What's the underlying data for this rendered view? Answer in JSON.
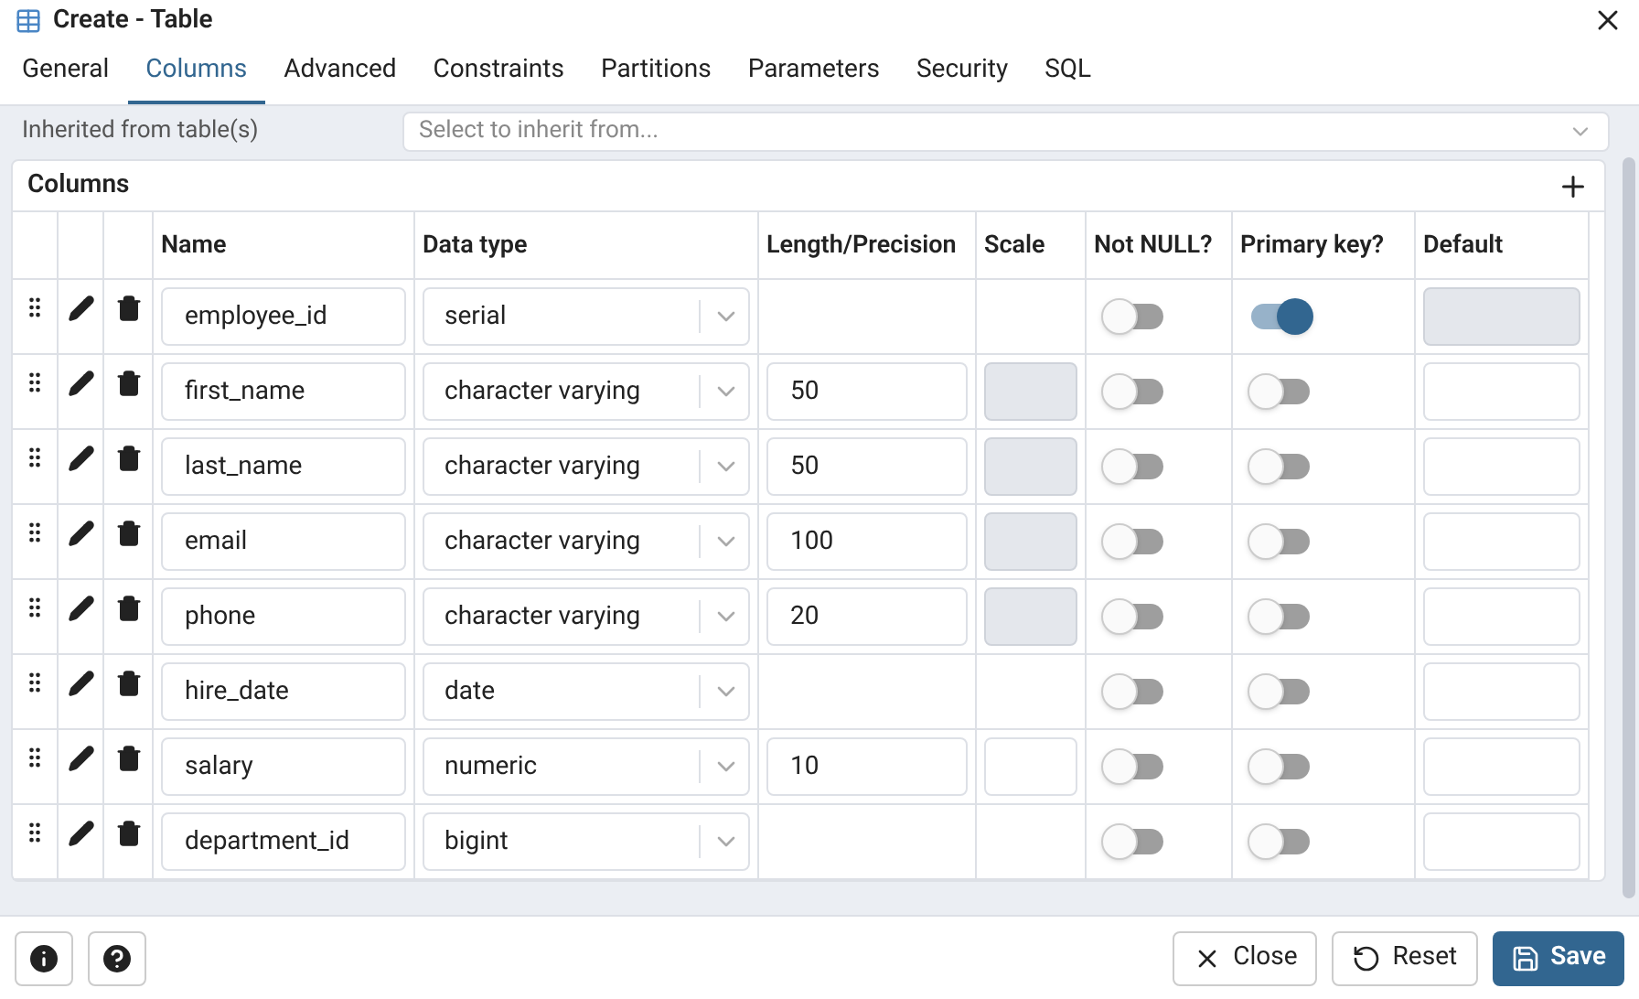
{
  "window": {
    "title": "Create - Table"
  },
  "tabs": [
    {
      "label": "General",
      "selected": false
    },
    {
      "label": "Columns",
      "selected": true
    },
    {
      "label": "Advanced",
      "selected": false
    },
    {
      "label": "Constraints",
      "selected": false
    },
    {
      "label": "Partitions",
      "selected": false
    },
    {
      "label": "Parameters",
      "selected": false
    },
    {
      "label": "Security",
      "selected": false
    },
    {
      "label": "SQL",
      "selected": false
    }
  ],
  "inherit": {
    "label": "Inherited from table(s)",
    "placeholder": "Select to inherit from..."
  },
  "columns_panel": {
    "title": "Columns",
    "headers": [
      "Name",
      "Data type",
      "Length/Precision",
      "Scale",
      "Not NULL?",
      "Primary key?",
      "Default"
    ],
    "rows": [
      {
        "name": "employee_id",
        "data_type": "serial",
        "not_null": false,
        "primary_key": true,
        "default_disabled": true
      },
      {
        "name": "first_name",
        "data_type": "character varying",
        "length": "50",
        "scale_disabled": true,
        "not_null": false,
        "primary_key": false,
        "default_disabled": false
      },
      {
        "name": "last_name",
        "data_type": "character varying",
        "length": "50",
        "scale_disabled": true,
        "not_null": false,
        "primary_key": false,
        "default_disabled": false
      },
      {
        "name": "email",
        "data_type": "character varying",
        "length": "100",
        "scale_disabled": true,
        "not_null": false,
        "primary_key": false,
        "default_disabled": false
      },
      {
        "name": "phone",
        "data_type": "character varying",
        "length": "20",
        "scale_disabled": true,
        "not_null": false,
        "primary_key": false,
        "default_disabled": false
      },
      {
        "name": "hire_date",
        "data_type": "date",
        "not_null": false,
        "primary_key": false,
        "default_disabled": false
      },
      {
        "name": "salary",
        "data_type": "numeric",
        "length": "10",
        "scale_disabled": false,
        "not_null": false,
        "primary_key": false,
        "default_disabled": false
      },
      {
        "name": "department_id",
        "data_type": "bigint",
        "not_null": false,
        "primary_key": false,
        "default_disabled": false
      }
    ]
  },
  "footer": {
    "buttons": [
      {
        "label": "Close",
        "kind": "close"
      },
      {
        "label": "Reset",
        "kind": "reset"
      },
      {
        "label": "Save",
        "kind": "save"
      }
    ]
  }
}
